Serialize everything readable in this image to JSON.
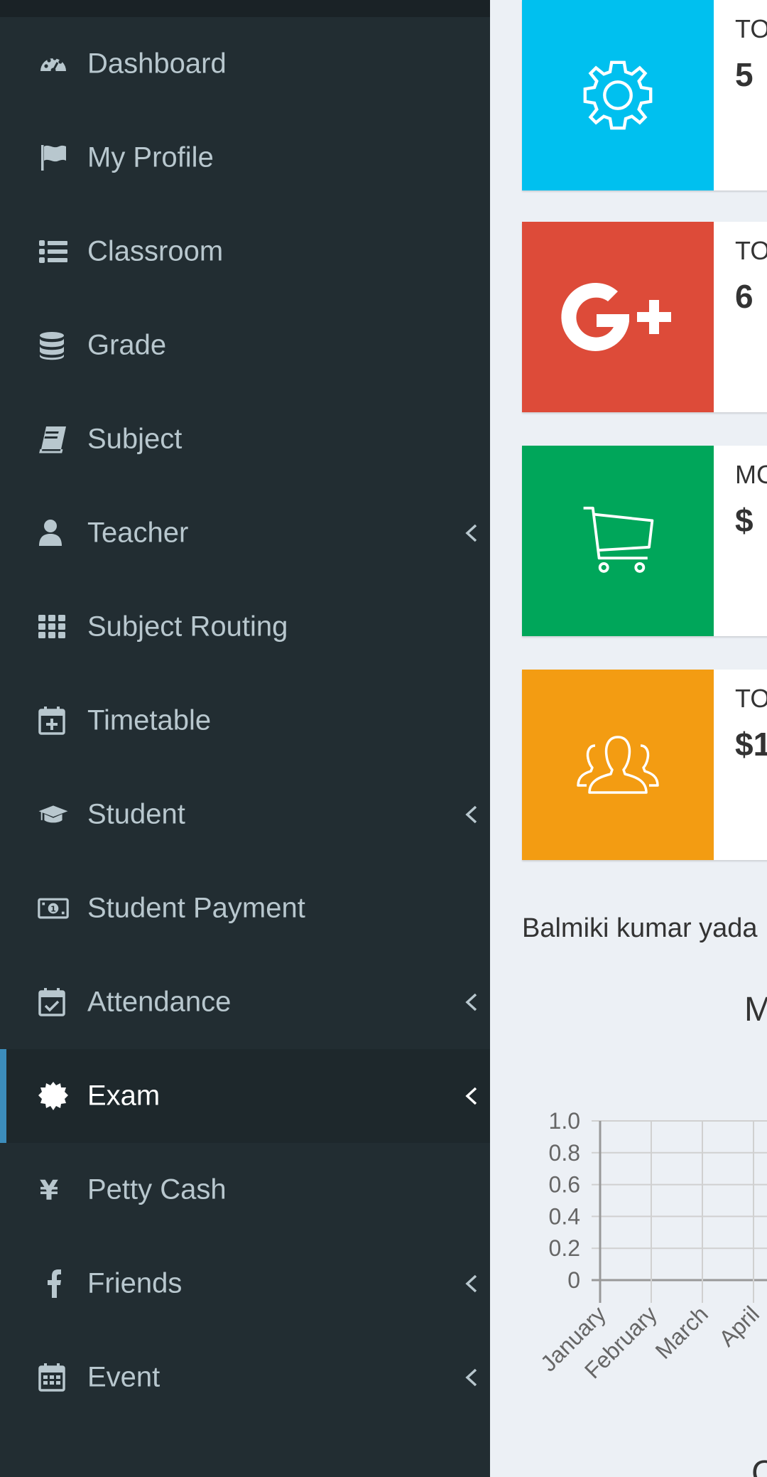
{
  "sidebar": {
    "items": [
      {
        "label": "Dashboard",
        "icon": "dashboard-icon",
        "has_submenu": false,
        "active": false
      },
      {
        "label": "My Profile",
        "icon": "flag-icon",
        "has_submenu": false,
        "active": false
      },
      {
        "label": "Classroom",
        "icon": "list-icon",
        "has_submenu": false,
        "active": false
      },
      {
        "label": "Grade",
        "icon": "database-icon",
        "has_submenu": false,
        "active": false
      },
      {
        "label": "Subject",
        "icon": "book-icon",
        "has_submenu": false,
        "active": false
      },
      {
        "label": "Teacher",
        "icon": "user-icon",
        "has_submenu": true,
        "active": false
      },
      {
        "label": "Subject Routing",
        "icon": "grid-icon",
        "has_submenu": false,
        "active": false
      },
      {
        "label": "Timetable",
        "icon": "calendar-plus-icon",
        "has_submenu": false,
        "active": false
      },
      {
        "label": "Student",
        "icon": "graduation-cap-icon",
        "has_submenu": true,
        "active": false
      },
      {
        "label": "Student Payment",
        "icon": "money-icon",
        "has_submenu": false,
        "active": false
      },
      {
        "label": "Attendance",
        "icon": "calendar-check-icon",
        "has_submenu": true,
        "active": false
      },
      {
        "label": "Exam",
        "icon": "certificate-icon",
        "has_submenu": true,
        "active": true
      },
      {
        "label": "Petty Cash",
        "icon": "yen-icon",
        "has_submenu": false,
        "active": false
      },
      {
        "label": "Friends",
        "icon": "facebook-icon",
        "has_submenu": true,
        "active": false
      },
      {
        "label": "Event",
        "icon": "calendar-icon",
        "has_submenu": true,
        "active": false
      }
    ]
  },
  "info_boxes": [
    {
      "text": "TO",
      "number": "5",
      "icon": "gear-icon",
      "color": "#00c0ef"
    },
    {
      "text": "TO",
      "number": "6",
      "icon": "google-plus-icon",
      "color": "#dd4b39"
    },
    {
      "text": "MC",
      "number": "$",
      "icon": "shopping-cart-icon",
      "color": "#00a65a"
    },
    {
      "text": "TO",
      "number": "$1",
      "icon": "users-icon",
      "color": "#f39c12"
    }
  ],
  "welcome_text": "Balmiki kumar yada",
  "chart_title": "M",
  "bottom_title": "C",
  "colors": {
    "sidebar_bg": "#222d32",
    "sidebar_active_bg": "#1e282c",
    "sidebar_active_accent": "#3c8dbc",
    "page_bg": "#ecf0f5"
  },
  "chart_data": {
    "type": "line",
    "categories": [
      "January",
      "February",
      "March",
      "April"
    ],
    "yticks": [
      "0",
      "0.2",
      "0.4",
      "0.6",
      "0.8",
      "1.0"
    ],
    "ylim": [
      0,
      1.0
    ],
    "grid": true,
    "series": []
  }
}
